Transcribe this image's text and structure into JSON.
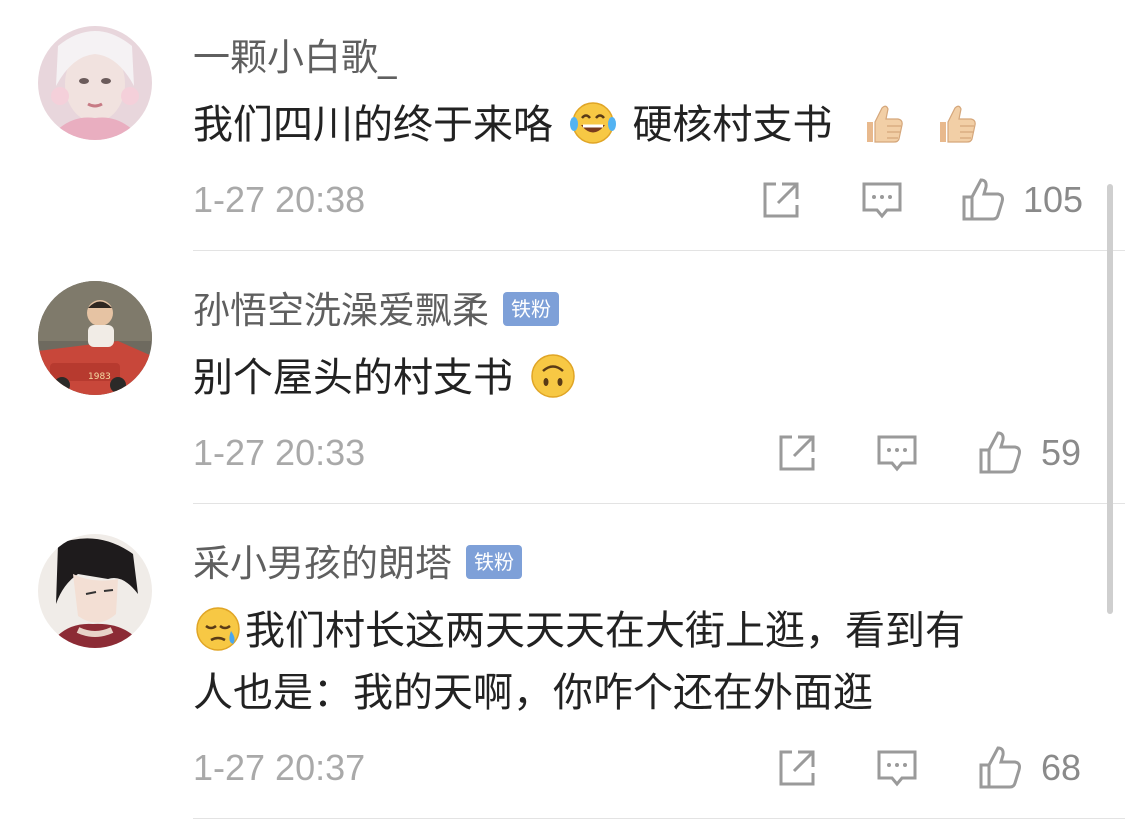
{
  "comments": [
    {
      "username": "一颗小白歌_",
      "badge": "",
      "text_parts": [
        "我们四川的终于来咯",
        "硬核村支书"
      ],
      "time": "1-27 20:38",
      "likes": "105"
    },
    {
      "username": "孙悟空洗澡爱飘柔",
      "badge": "铁粉",
      "text_parts": [
        "别个屋头的村支书"
      ],
      "time": "1-27 20:33",
      "likes": "59"
    },
    {
      "username": "采小男孩的朗塔",
      "badge": "铁粉",
      "text_line1": "我们村长这两天天天在大街上逛，看到有",
      "text_line2": "人也是：我的天啊，你咋个还在外面逛",
      "time": "1-27 20:37",
      "likes": "68"
    }
  ],
  "colors": {
    "badge": "#7ea0d8",
    "meta_text": "#a9a9a9",
    "icon": "#9a9a9a",
    "divider": "#e3e3e3"
  },
  "icons": {
    "repost": "repost-icon",
    "comment": "comment-icon",
    "like": "like-icon"
  }
}
